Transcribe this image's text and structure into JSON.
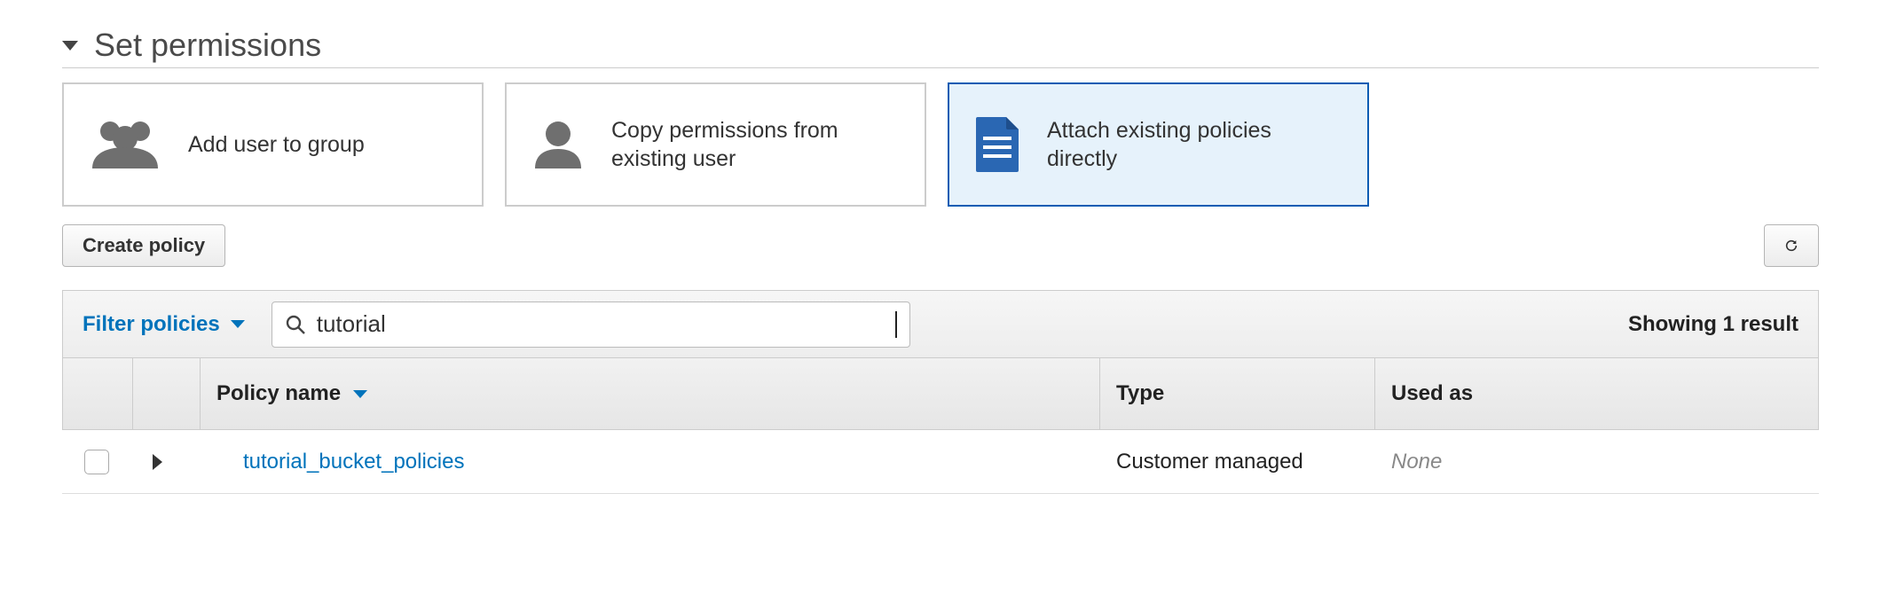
{
  "section": {
    "title": "Set permissions"
  },
  "options": {
    "add_group": "Add user to group",
    "copy_user": "Copy permissions from existing user",
    "attach_policies": "Attach existing policies directly"
  },
  "toolbar": {
    "create_policy": "Create policy"
  },
  "filter": {
    "label": "Filter policies",
    "search_value": "tutorial",
    "result_text": "Showing 1 result"
  },
  "columns": {
    "policy_name": "Policy name",
    "type": "Type",
    "used_as": "Used as"
  },
  "rows": [
    {
      "name": "tutorial_bucket_policies",
      "type": "Customer managed",
      "used_as": "None"
    }
  ]
}
